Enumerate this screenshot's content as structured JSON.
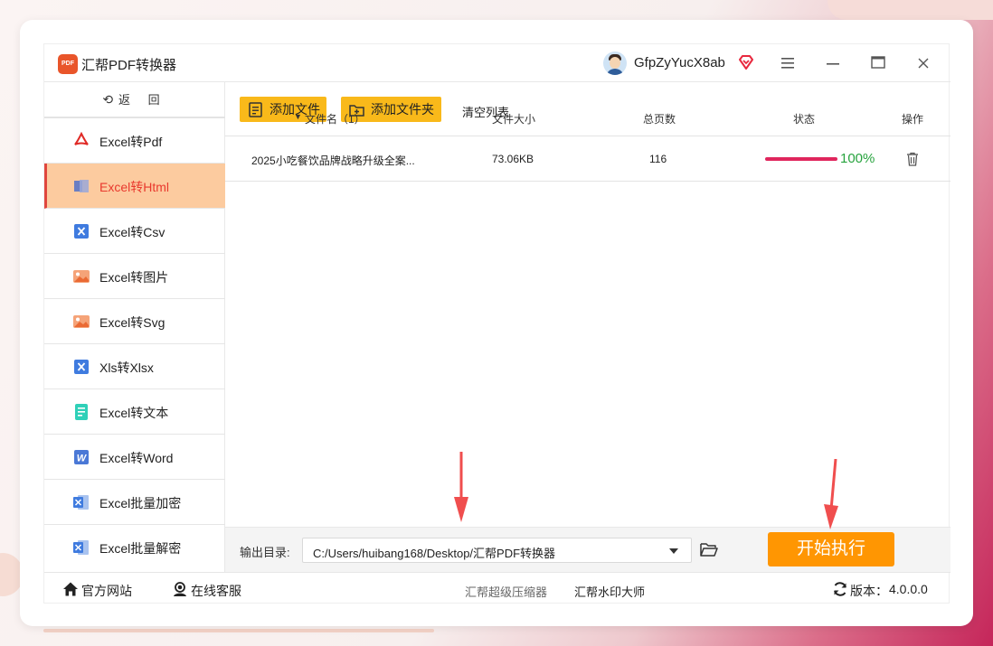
{
  "app": {
    "title": "汇帮PDF转换器",
    "logo_text": "PDF",
    "username": "GfpZyYucX8ab",
    "icons": [
      "avatar",
      "vip-diamond-icon",
      "menu-icon",
      "minimize-icon",
      "maximize-icon",
      "close-icon"
    ]
  },
  "sidebar": {
    "back_label": "返 回",
    "items": [
      {
        "label": "Excel转Pdf",
        "icon": "pdf-icon",
        "active": false
      },
      {
        "label": "Excel转Html",
        "icon": "html-icon",
        "active": true
      },
      {
        "label": "Excel转Csv",
        "icon": "excel-icon",
        "active": false
      },
      {
        "label": "Excel转图片",
        "icon": "image-icon",
        "active": false
      },
      {
        "label": "Excel转Svg",
        "icon": "image-icon",
        "active": false
      },
      {
        "label": "Xls转Xlsx",
        "icon": "excel-icon",
        "active": false
      },
      {
        "label": "Excel转文本",
        "icon": "text-icon",
        "active": false
      },
      {
        "label": "Excel转Word",
        "icon": "word-icon",
        "active": false
      },
      {
        "label": "Excel批量加密",
        "icon": "excel-lock-icon",
        "active": false
      },
      {
        "label": "Excel批量解密",
        "icon": "excel-unlock-icon",
        "active": false
      }
    ]
  },
  "toolbar": {
    "add_file_label": "添加文件",
    "add_folder_label": "添加文件夹",
    "clear_label": "清空列表"
  },
  "table": {
    "headers": {
      "filename": "文件名（1）",
      "size": "文件大小",
      "pages": "总页数",
      "status": "状态",
      "action": "操作"
    },
    "rows": [
      {
        "filename": "2025小吃餐饮品牌战略升级全案...",
        "size": "73.06KB",
        "pages": "116",
        "progress": 100,
        "progress_text": "100%"
      }
    ]
  },
  "output": {
    "label": "输出目录:",
    "path": "C:/Users/huibang168/Desktop/汇帮PDF转换器",
    "start_label": "开始执行"
  },
  "footer": {
    "website_label": "官方网站",
    "support_label": "在线客服",
    "compressor_label": "汇帮超级压缩器",
    "watermark_label": "汇帮水印大师",
    "version_label": "版本：",
    "version": "4.0.0.0"
  },
  "colors": {
    "accent_yellow": "#f9b91a",
    "start_orange": "#ff9602",
    "active_bg": "#fccb9f",
    "active_text": "#e9392e",
    "progress": "#e0265d",
    "progress_text": "#27a33e",
    "arrow_red": "#f04e4e"
  }
}
